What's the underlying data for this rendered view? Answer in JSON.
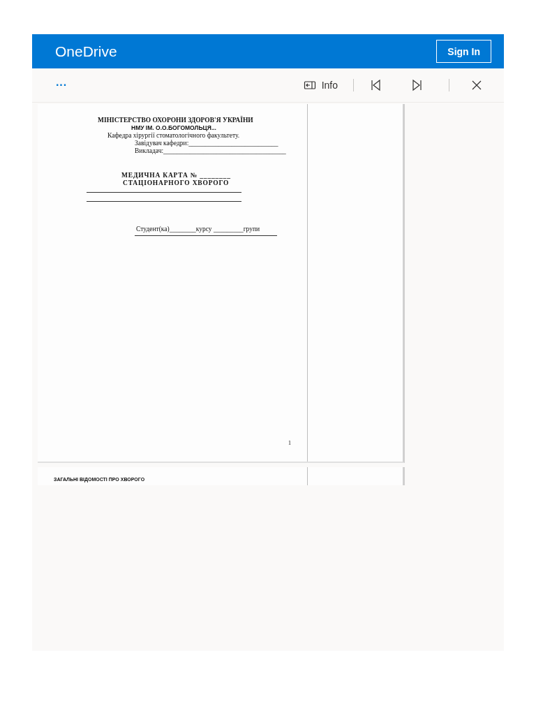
{
  "header": {
    "app_title": "OneDrive",
    "sign_in": "Sign In"
  },
  "toolbar": {
    "more": "···",
    "info": "Info"
  },
  "pages": [
    {
      "ministry": "МІНІСТЕРСТВО ОХОРОНИ ЗДОРОВ'Я УКРАЇНИ",
      "university": "НМУ ІМ. О.О.БОГОМОЛЬЦЯ...",
      "department": "Кафедра  хірургії стоматологічного факультету.",
      "head": "Завідувач кафедри:___________________________",
      "teacher": "Викладач:_____________________________________",
      "card_title": "МЕДИЧНА КАРТА № ________",
      "card_subtitle": "СТАЦІОНАРНОГО ХВОРОГО",
      "student": "Студент(ка)________курсу _________групи",
      "page_number": "1"
    },
    {
      "heading": "ЗАГАЛЬНІ ВІДОМОСТІ ПРО ХВОРОГО"
    }
  ]
}
